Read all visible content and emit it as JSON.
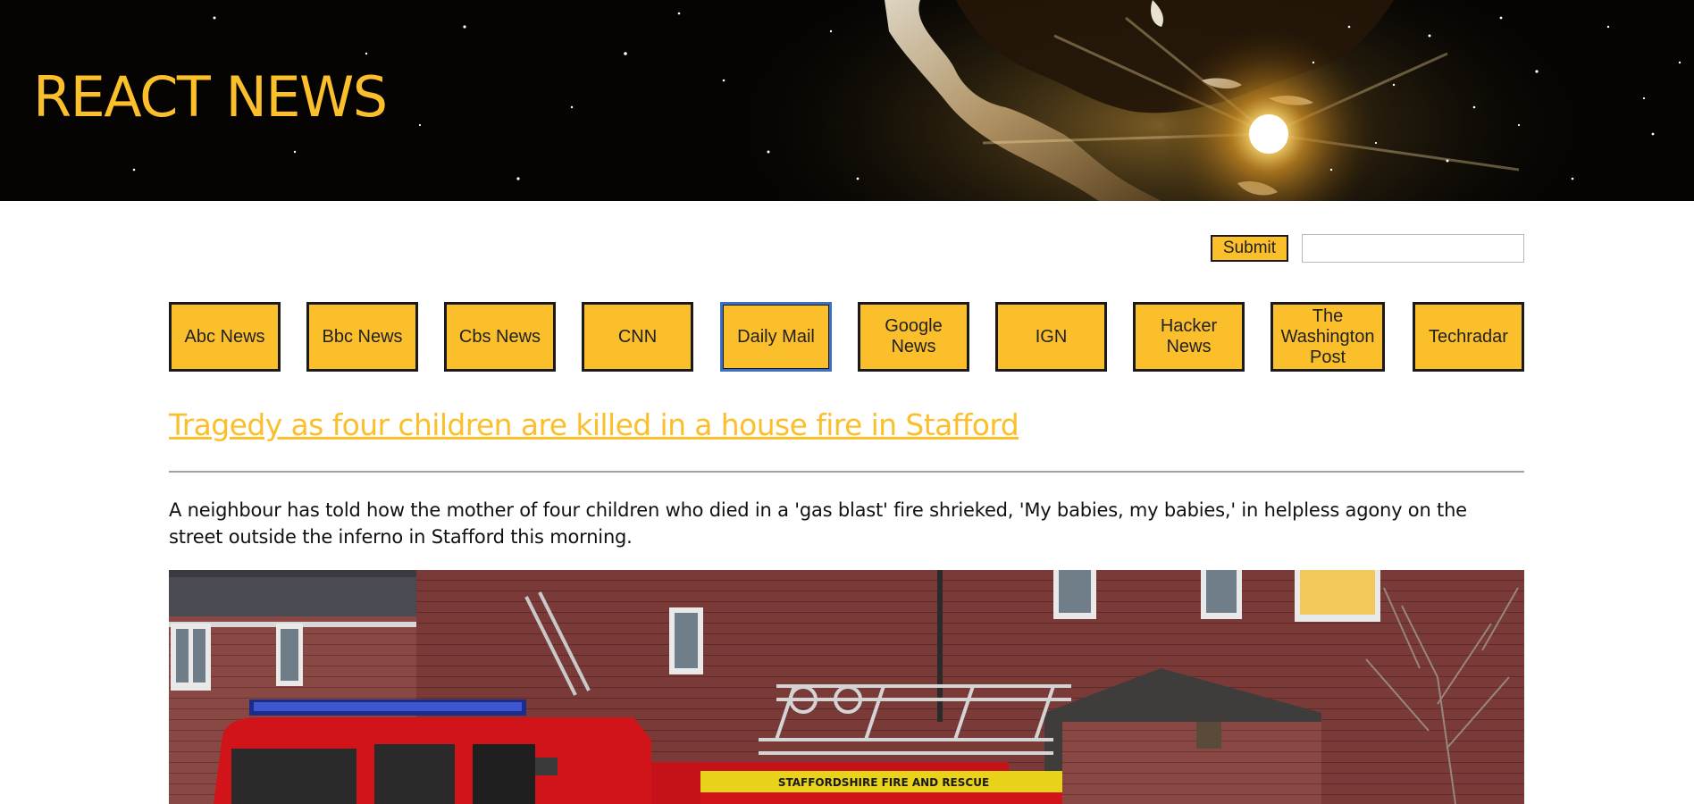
{
  "brand": {
    "title": "REACT NEWS"
  },
  "search": {
    "submit_label": "Submit",
    "value": "",
    "placeholder": ""
  },
  "sources": [
    {
      "label": "Abc News",
      "active": false
    },
    {
      "label": "Bbc News",
      "active": false
    },
    {
      "label": "Cbs News",
      "active": false
    },
    {
      "label": "CNN",
      "active": false
    },
    {
      "label": "Daily Mail",
      "active": true
    },
    {
      "label": "Google News",
      "active": false
    },
    {
      "label": "IGN",
      "active": false
    },
    {
      "label": "Hacker News",
      "active": false
    },
    {
      "label": "The Washington Post",
      "active": false
    },
    {
      "label": "Techradar",
      "active": false
    }
  ],
  "article": {
    "headline": "Tragedy as four children are killed in a house fire in Stafford",
    "summary": "A neighbour has told how the mother of four children who died in a 'gas blast' fire shrieked, 'My babies, my babies,' in helpless agony on the street outside the inferno in Stafford this morning.",
    "image_truck_text": "STAFFORDSHIRE FIRE AND RESCUE"
  },
  "colors": {
    "accent": "#fbbf2c",
    "header_bg": "#050403",
    "text": "#111111",
    "active_border": "#3a6fc4"
  }
}
